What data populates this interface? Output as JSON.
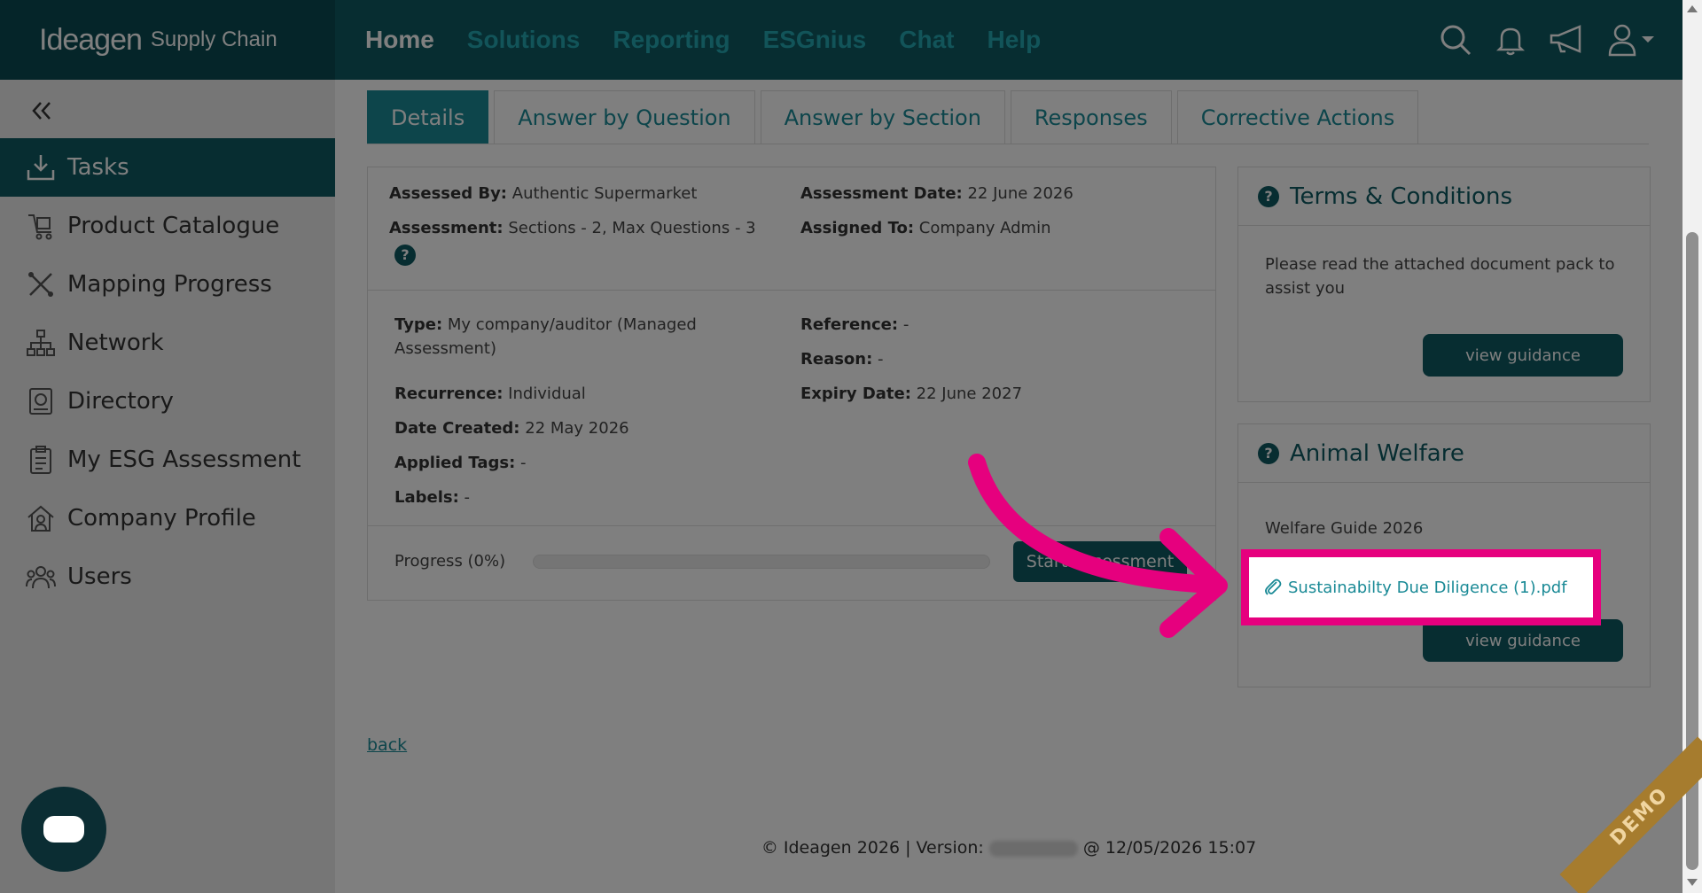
{
  "brand": {
    "name": "Ideagen",
    "product": "Supply Chain"
  },
  "nav": [
    "Home",
    "Solutions",
    "Reporting",
    "ESGnius",
    "Chat",
    "Help"
  ],
  "icons": [
    "search-icon",
    "bell-icon",
    "megaphone-icon",
    "user-icon"
  ],
  "sidebar": {
    "items": [
      {
        "label": "Tasks",
        "icon": "download-tray-icon"
      },
      {
        "label": "Product Catalogue",
        "icon": "cart-icon"
      },
      {
        "label": "Mapping Progress",
        "icon": "route-icon"
      },
      {
        "label": "Network",
        "icon": "network-icon"
      },
      {
        "label": "Directory",
        "icon": "directory-icon"
      },
      {
        "label": "My ESG Assessment",
        "icon": "clipboard-icon"
      },
      {
        "label": "Company Profile",
        "icon": "house-icon"
      },
      {
        "label": "Users",
        "icon": "users-icon"
      }
    ]
  },
  "tabs": [
    "Details",
    "Answer by Question",
    "Answer by Section",
    "Responses",
    "Corrective Actions"
  ],
  "details": {
    "assessed_by_label": "Assessed By:",
    "assessed_by": "Authentic Supermarket",
    "assessment_date_label": "Assessment Date:",
    "assessment_date": "22 June 2026",
    "assessment_label": "Assessment:",
    "assessment": "Sections - 2, Max Questions - 3",
    "assigned_to_label": "Assigned To:",
    "assigned_to": "Company Admin",
    "type_label": "Type:",
    "type": "My company/auditor (Managed Assessment)",
    "reference_label": "Reference:",
    "reference": "-",
    "reason_label": "Reason:",
    "reason": "-",
    "recurrence_label": "Recurrence:",
    "recurrence": "Individual",
    "expiry_label": "Expiry Date:",
    "expiry": "22 June 2027",
    "created_label": "Date Created:",
    "created": "22 May 2026",
    "tags_label": "Applied Tags:",
    "tags": "-",
    "labels_label": "Labels:",
    "labels": "-",
    "progress_label": "Progress (0%)",
    "progress": 0,
    "start_button": "Start Assessment"
  },
  "terms": {
    "title": "Terms & Conditions",
    "text": "Please read the attached document pack to assist you",
    "button": "view guidance"
  },
  "welfare": {
    "title": "Animal Welfare",
    "guide": "Welfare Guide 2026",
    "file": "Sustainabilty Due Diligence (1).pdf",
    "button": "view guidance"
  },
  "back": "back",
  "footer": {
    "left": "© Ideagen 2026 | Version:",
    "right": "@ 12/05/2026 15:07"
  },
  "demo": "DEMO",
  "colors": {
    "primary": "#0e5a62",
    "accent": "#1a8a96",
    "highlight": "#e6007e"
  }
}
